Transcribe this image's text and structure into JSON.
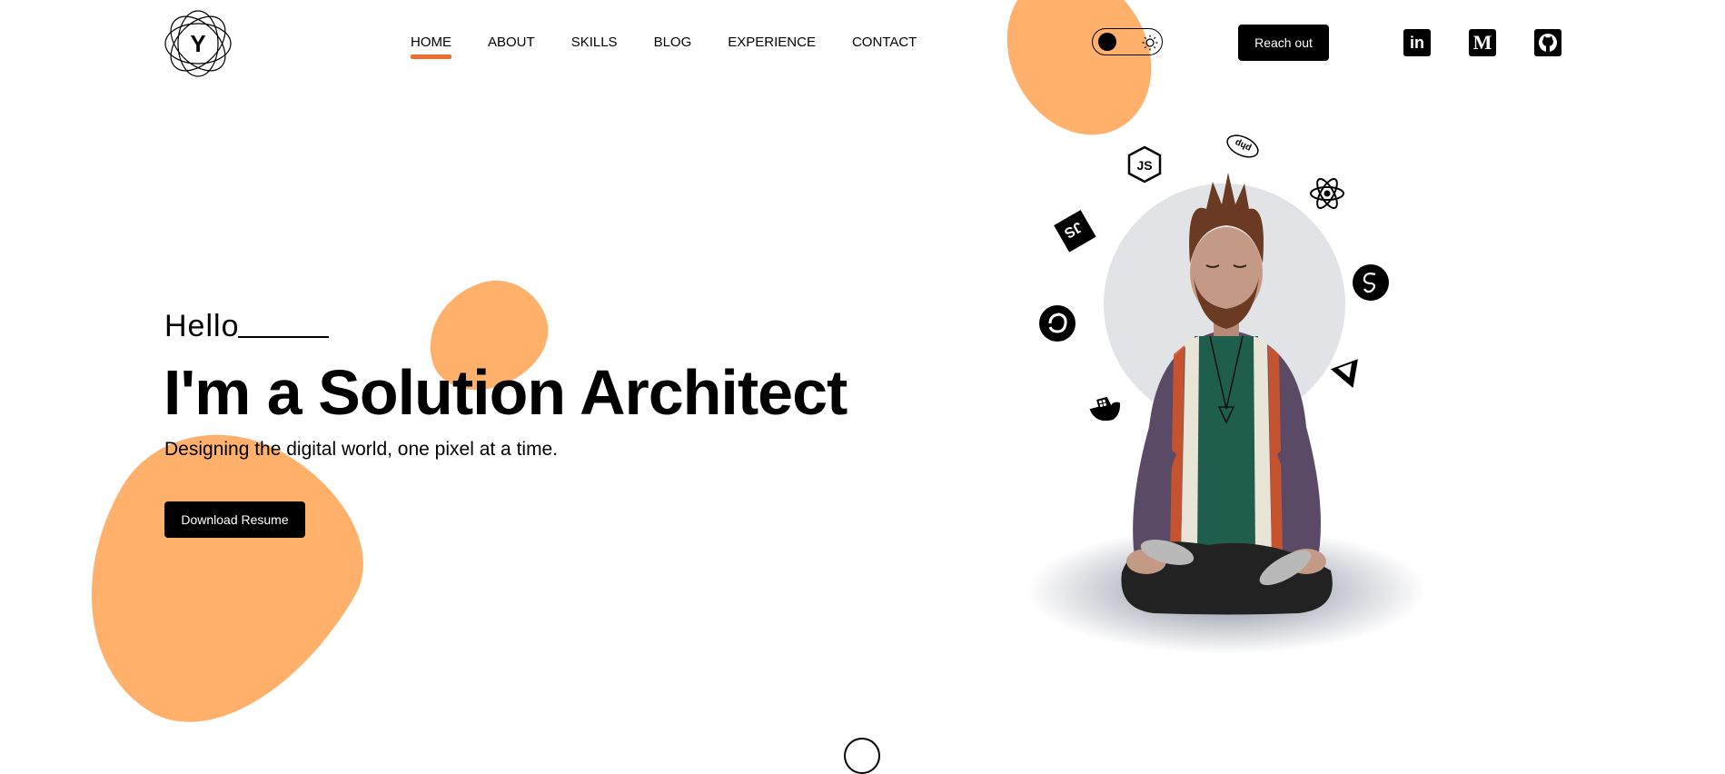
{
  "logo": {
    "letter": "Y"
  },
  "nav": {
    "items": [
      {
        "label": "HOME",
        "active": true
      },
      {
        "label": "ABOUT",
        "active": false
      },
      {
        "label": "SKILLS",
        "active": false
      },
      {
        "label": "BLOG",
        "active": false
      },
      {
        "label": "EXPERIENCE",
        "active": false
      },
      {
        "label": "CONTACT",
        "active": false
      }
    ]
  },
  "theme_toggle": {
    "icon": "sun-icon",
    "state": "light"
  },
  "header": {
    "cta_label": "Reach out"
  },
  "social": [
    {
      "name": "linkedin",
      "glyph": "in"
    },
    {
      "name": "medium",
      "glyph": "M"
    },
    {
      "name": "github",
      "glyph": "github-icon"
    }
  ],
  "hero": {
    "greeting": "Hello",
    "headline": "I'm a Solution Architect",
    "tagline": "Designing the digital world, one pixel at a time.",
    "download_label": "Download Resume"
  },
  "tech_icons": [
    "nodejs-icon",
    "php-icon",
    "react-icon",
    "javascript-icon",
    "sass-icon",
    "redux-icon",
    "vue-icon",
    "docker-icon"
  ],
  "colors": {
    "accent": "#ffb06b",
    "active_underline": "#f06b2c",
    "button_bg": "#000000"
  }
}
